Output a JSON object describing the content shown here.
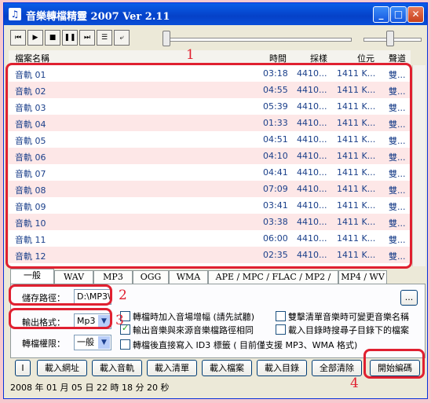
{
  "window": {
    "title": "音樂轉檔精靈 2007 Ver 2.11",
    "app_icon": "♫"
  },
  "columns": [
    "檔案名稱",
    "時間",
    "採樣",
    "位元",
    "聲道"
  ],
  "tracks": [
    {
      "name": "音軌 01",
      "time": "03:18",
      "rate": "4410...",
      "bits": "1411 K...",
      "ch": "雙..."
    },
    {
      "name": "音軌 02",
      "time": "04:55",
      "rate": "4410...",
      "bits": "1411 K...",
      "ch": "雙..."
    },
    {
      "name": "音軌 03",
      "time": "05:39",
      "rate": "4410...",
      "bits": "1411 K...",
      "ch": "雙..."
    },
    {
      "name": "音軌 04",
      "time": "01:33",
      "rate": "4410...",
      "bits": "1411 K...",
      "ch": "雙..."
    },
    {
      "name": "音軌 05",
      "time": "04:51",
      "rate": "4410...",
      "bits": "1411 K...",
      "ch": "雙..."
    },
    {
      "name": "音軌 06",
      "time": "04:10",
      "rate": "4410...",
      "bits": "1411 K...",
      "ch": "雙..."
    },
    {
      "name": "音軌 07",
      "time": "04:41",
      "rate": "4410...",
      "bits": "1411 K...",
      "ch": "雙..."
    },
    {
      "name": "音軌 08",
      "time": "07:09",
      "rate": "4410...",
      "bits": "1411 K...",
      "ch": "雙..."
    },
    {
      "name": "音軌 09",
      "time": "03:41",
      "rate": "4410...",
      "bits": "1411 K...",
      "ch": "雙..."
    },
    {
      "name": "音軌 10",
      "time": "03:38",
      "rate": "4410...",
      "bits": "1411 K...",
      "ch": "雙..."
    },
    {
      "name": "音軌 11",
      "time": "06:00",
      "rate": "4410...",
      "bits": "1411 K...",
      "ch": "雙..."
    },
    {
      "name": "音軌 12",
      "time": "02:35",
      "rate": "4410...",
      "bits": "1411 K...",
      "ch": "雙..."
    }
  ],
  "tabs": [
    "一般",
    "WAV",
    "MP3",
    "OGG",
    "WMA",
    "APE / MPC / FLAC / MP2 / AC3",
    "MP4 / WV"
  ],
  "settings": {
    "save_path_label": "儲存路徑：",
    "save_path_value": "D:\\MP3\\",
    "browse_label": "...",
    "format_label": "輸出格式：",
    "format_value": "Mp3",
    "priority_label": "轉檔權限：",
    "priority_value": "一般",
    "options": [
      "轉檔時加入音場增幅 (請先試聽)",
      "輸出音樂與來源音樂檔路徑相同",
      "轉檔後直接寫入 ID3 標籤 ( 目前僅支援 MP3、WMA 格式)",
      "雙擊清單音樂時可變更音樂名稱",
      "載入目錄時搜尋子目錄下的檔案"
    ],
    "options_checked": [
      false,
      true,
      false,
      false,
      false
    ]
  },
  "buttons": {
    "info": "I",
    "load_url": "載入網址",
    "load_track": "載入音軌",
    "load_list": "載入清單",
    "load_file": "載入檔案",
    "load_dir": "載入目錄",
    "clear_all": "全部清除",
    "start": "開始編碼"
  },
  "status_text": "2008 年 01 月 05 日 22 時 18 分 20 秒",
  "annotations": [
    "1",
    "2",
    "3",
    "4"
  ],
  "colors": {
    "annotation": "#e02030",
    "track_text": "#1a3f8a",
    "row_alt": "#fde7e7"
  }
}
